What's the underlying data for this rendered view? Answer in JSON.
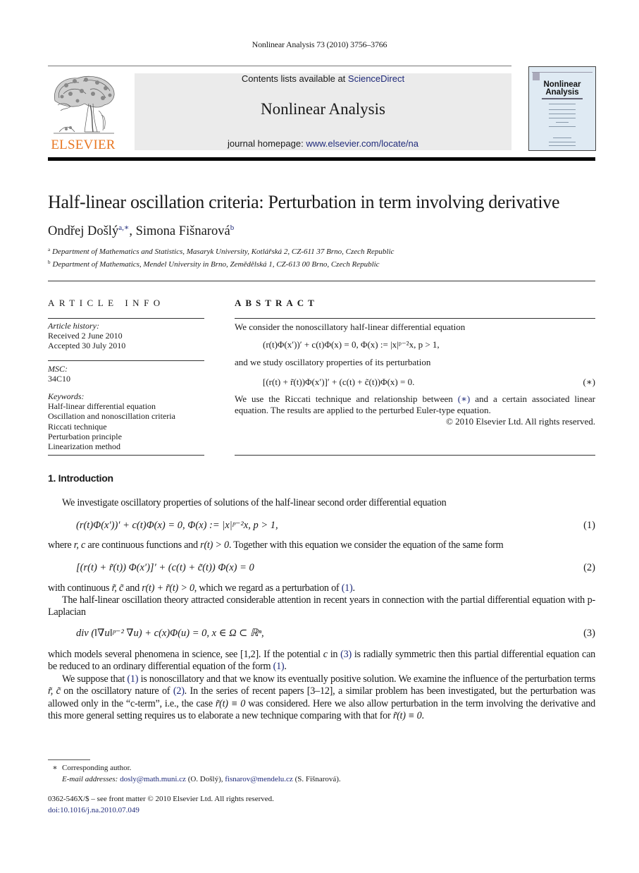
{
  "running_head": "Nonlinear Analysis 73 (2010) 3756–3766",
  "publisher": {
    "logo_icon": "elsevier-tree-logo",
    "logo_text": "ELSEVIER",
    "brand_color": "#e87722"
  },
  "banner": {
    "contents_prefix": "Contents lists available at ",
    "contents_link": "ScienceDirect",
    "journal_title": "Nonlinear Analysis",
    "homepage_prefix": "journal homepage: ",
    "homepage_link": "www.elsevier.com/locate/na",
    "background_color": "#ebebeb",
    "link_color": "#1f2a7a"
  },
  "cover": {
    "title_line1": "Nonlinear",
    "title_line2": "Analysis",
    "icon": "journal-cover-thumbnail"
  },
  "article": {
    "title": "Half-linear oscillation criteria: Perturbation in term involving derivative",
    "authors": [
      {
        "name": "Ondřej Došlý",
        "marks": "a,∗"
      },
      {
        "name": "Simona Fišnarová",
        "marks": "b"
      }
    ],
    "author_separator": ", ",
    "affiliations": [
      {
        "mark": "a",
        "text": "Department of Mathematics and Statistics, Masaryk University, Kotlářská 2, CZ-611 37 Brno, Czech Republic"
      },
      {
        "mark": "b",
        "text": "Department of Mathematics, Mendel University in Brno, Zemědělská 1, CZ-613 00 Brno, Czech Republic"
      }
    ]
  },
  "article_info": {
    "heading": "ARTICLE INFO",
    "history_label": "Article history:",
    "received": "Received 2 June 2010",
    "accepted": "Accepted 30 July 2010",
    "msc_label": "MSC:",
    "msc_value": "34C10",
    "keywords_label": "Keywords:",
    "keywords": [
      "Half-linear differential equation",
      "Oscillation and nonoscillation criteria",
      "Riccati technique",
      "Perturbation principle",
      "Linearization method"
    ]
  },
  "abstract": {
    "heading": "ABSTRACT",
    "p1": "We consider the nonoscillatory half-linear differential equation",
    "eq1": "(r(t)Φ(x′))′ + c(t)Φ(x) = 0,    Φ(x) := |x|ᵖ⁻²x, p > 1,",
    "p2": "and we study oscillatory properties of its perturbation",
    "eq2": "[(r(t) + r̃(t))Φ(x′)]′ + (c(t) + c̃(t))Φ(x) = 0.",
    "eq2_label": "(∗)",
    "p3_prefix": "We use the Riccati technique and relationship between ",
    "p3_ref": "(∗)",
    "p3_suffix": " and a certain associated linear equation. The results are applied to the perturbed Euler-type equation.",
    "copyright": "© 2010 Elsevier Ltd. All rights reserved."
  },
  "section1": {
    "heading": "1.  Introduction",
    "p1": "We investigate oscillatory properties of solutions of the half-linear second order differential equation",
    "eq1": "(r(t)Φ(x′))′ + c(t)Φ(x) = 0,    Φ(x) := |x|ᵖ⁻²x,  p > 1,",
    "eq1_label": "(1)",
    "p2_a": "where ",
    "p2_vars": "r, c",
    "p2_b": " are continuous functions and ",
    "p2_cond": "r(t) > 0",
    "p2_c": ". Together with this equation we consider the equation of the same form",
    "eq2": "[(r(t) + r̃(t)) Φ(x′)]′ + (c(t) + c̃(t)) Φ(x) = 0",
    "eq2_label": "(2)",
    "p3_a": "with continuous ",
    "p3_vars": "r̃, c̃",
    "p3_b": " and ",
    "p3_cond": "r(t) + r̃(t) > 0",
    "p3_c": ", which we regard as a perturbation of ",
    "p3_ref": "(1)",
    "p3_d": ".",
    "p4": "The half-linear oscillation theory attracted considerable attention in recent years in connection with the partial differential equation with p-Laplacian",
    "eq3": "div (‖∇u‖ᵖ⁻² ∇u) + c(x)Φ(u) = 0,    x ∈ Ω ⊂ ℝⁿ,",
    "eq3_label": "(3)",
    "p5_a": "which models several phenomena in science, see [1,2]. If the potential ",
    "p5_var": "c",
    "p5_b": " in ",
    "p5_ref1": "(3)",
    "p5_c": " is radially symmetric then this partial differential equation can be reduced to an ordinary differential equation of the form ",
    "p5_ref2": "(1)",
    "p5_d": ".",
    "p6_a": "We suppose that ",
    "p6_ref1": "(1)",
    "p6_b": " is nonoscillatory and that we know its eventually positive solution. We examine the influence of the perturbation terms ",
    "p6_vars": "r̃, c̃",
    "p6_c": " on the oscillatory nature of ",
    "p6_ref2": "(2)",
    "p6_d": ". In the series of recent papers [3–12], a similar problem has been investigated, but the perturbation was allowed only in the “c-term”, i.e., the case ",
    "p6_cond1": "r̃(t) ≡ 0",
    "p6_e": " was considered. Here we also allow perturbation in the term involving the derivative and this more general setting requires us to elaborate a new technique comparing with that for ",
    "p6_cond2": "r̃(t) ≡ 0",
    "p6_f": "."
  },
  "footnotes": {
    "mark": "∗",
    "corresponding": "Corresponding author.",
    "email_label": "E-mail addresses: ",
    "email1": "dosly@math.muni.cz",
    "email1_owner": " (O. Došlý), ",
    "email2": "fisnarov@mendelu.cz",
    "email2_owner": " (S. Fišnarová)."
  },
  "front_matter": {
    "issn_line": "0362-546X/$ – see front matter © 2010 Elsevier Ltd. All rights reserved.",
    "doi": "doi:10.1016/j.na.2010.07.049"
  }
}
